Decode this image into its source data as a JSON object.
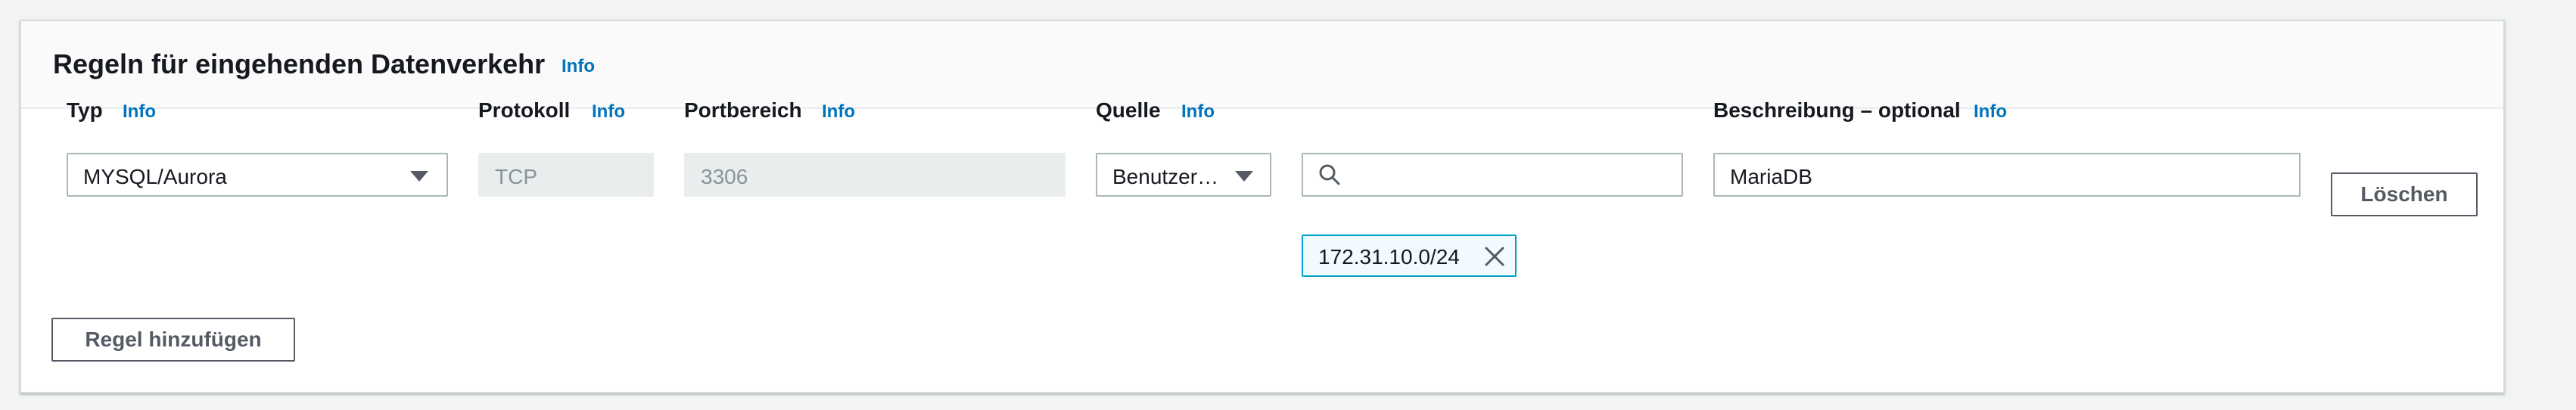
{
  "panel": {
    "title": "Regeln für eingehenden Datenverkehr",
    "info": "Info"
  },
  "columns": {
    "type": {
      "label": "Typ",
      "info": "Info"
    },
    "protocol": {
      "label": "Protokoll",
      "info": "Info"
    },
    "port_range": {
      "label": "Portbereich",
      "info": "Info"
    },
    "source": {
      "label": "Quelle",
      "info": "Info"
    },
    "description": {
      "label": "Beschreibung – optional",
      "info": "Info"
    }
  },
  "rule": {
    "type_value": "MYSQL/Aurora",
    "protocol_value": "TCP",
    "port_range_value": "3306",
    "source_type_value": "Benutzer…",
    "source_search_value": "",
    "source_token": "172.31.10.0/24",
    "description_value": "MariaDB",
    "delete_label": "Löschen"
  },
  "actions": {
    "add_rule_label": "Regel hinzufügen"
  },
  "icons": {
    "caret": "caret-down-icon",
    "search": "search-icon",
    "remove": "close-icon"
  },
  "colors": {
    "link": "#0073bb",
    "token_border": "#00a1c9",
    "token_bg": "#f1faff"
  }
}
